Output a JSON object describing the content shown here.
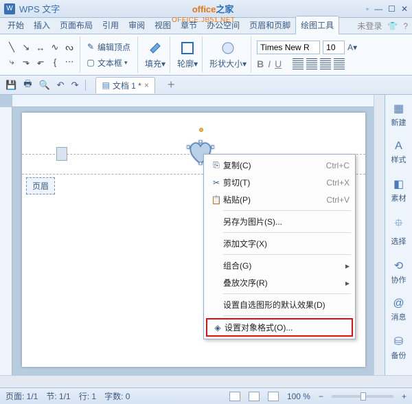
{
  "title": "WPS 文字",
  "watermark": {
    "part1": "office",
    "part2": "之家",
    "sub": "OFFICE.JB51.NET"
  },
  "tabs": [
    "开始",
    "插入",
    "页面布局",
    "引用",
    "审阅",
    "视图",
    "章节",
    "办公空间",
    "页眉和页脚",
    "绘图工具"
  ],
  "active_tab_index": 9,
  "login": "未登录",
  "ribbon": {
    "edit_vertex": "编辑顶点",
    "textbox": "文本框",
    "fill": "填充",
    "outline": "轮廓",
    "shape_size": "形状大小",
    "font_name": "Times New R",
    "font_size": "10"
  },
  "doc_tab": "文档 1 *",
  "page_header_label": "页眉",
  "context_menu": [
    {
      "icon": "⎘",
      "label": "复制(C)",
      "shortcut": "Ctrl+C"
    },
    {
      "icon": "✂",
      "label": "剪切(T)",
      "shortcut": "Ctrl+X"
    },
    {
      "icon": "📋",
      "label": "粘贴(P)",
      "shortcut": "Ctrl+V"
    },
    {
      "sep": true
    },
    {
      "label": "另存为图片(S)...",
      "shortcut": ""
    },
    {
      "sep": true
    },
    {
      "label": "添加文字(X)",
      "shortcut": ""
    },
    {
      "sep": true
    },
    {
      "label": "组合(G)",
      "arrow": true
    },
    {
      "label": "叠放次序(R)",
      "arrow": true
    },
    {
      "sep": true
    },
    {
      "label": "设置自选图形的默认效果(D)",
      "shortcut": ""
    },
    {
      "sep": true
    },
    {
      "icon": "◈",
      "label": "设置对象格式(O)...",
      "boxed": true
    }
  ],
  "sidepanel": [
    {
      "icon": "▦",
      "label": "新建"
    },
    {
      "icon": "A",
      "label": "样式"
    },
    {
      "icon": "◧",
      "label": "素材"
    },
    {
      "icon": "⯐",
      "label": "选择"
    },
    {
      "icon": "⟲",
      "label": "协作"
    },
    {
      "icon": "@",
      "label": "消息"
    },
    {
      "icon": "⛁",
      "label": "备份"
    }
  ],
  "status": {
    "page": "页面: 1/1",
    "section": "节: 1/1",
    "row": "行: 1",
    "chars": "字数: 0",
    "zoom": "100 %"
  }
}
